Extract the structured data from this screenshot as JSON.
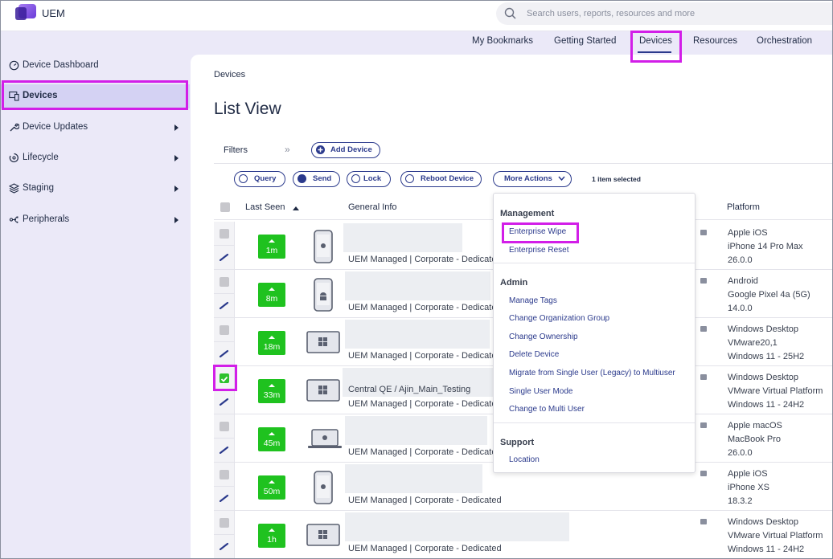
{
  "app": {
    "name": "UEM"
  },
  "search": {
    "placeholder": "Search users, reports, resources and more"
  },
  "topnav": [
    {
      "label": "My Bookmarks",
      "active": false
    },
    {
      "label": "Getting Started",
      "active": false
    },
    {
      "label": "Devices",
      "active": true
    },
    {
      "label": "Resources",
      "active": false
    },
    {
      "label": "Orchestration",
      "active": false
    }
  ],
  "sidebar": {
    "items": [
      {
        "label": "Device Dashboard",
        "icon": "dashboard-icon",
        "active": false,
        "expandable": false
      },
      {
        "label": "Devices",
        "icon": "devices-icon",
        "active": true,
        "expandable": false
      },
      {
        "label": "Device Updates",
        "icon": "wrench-icon",
        "active": false,
        "expandable": true
      },
      {
        "label": "Lifecycle",
        "icon": "lifecycle-icon",
        "active": false,
        "expandable": true
      },
      {
        "label": "Staging",
        "icon": "staging-icon",
        "active": false,
        "expandable": true
      },
      {
        "label": "Peripherals",
        "icon": "peripherals-icon",
        "active": false,
        "expandable": true
      }
    ]
  },
  "main": {
    "breadcrumb": "Devices",
    "title": "List View",
    "filters_label": "Filters",
    "add_device": "Add Device",
    "actions": {
      "query": "Query",
      "send": "Send",
      "lock": "Lock",
      "reboot": "Reboot Device",
      "more": "More Actions"
    },
    "selection_count": "1 item selected",
    "columns": {
      "last_seen": "Last Seen",
      "general_info": "General Info",
      "platform": "Platform"
    }
  },
  "rows": [
    {
      "last_seen": "1m",
      "device": "phone-ios-icon",
      "checked": false,
      "line1": "",
      "line2": "UEM Managed | Corporate - Dedicated",
      "platform": [
        "Apple iOS",
        "iPhone 14 Pro Max",
        "26.0.0"
      ]
    },
    {
      "last_seen": "8m",
      "device": "phone-android-icon",
      "checked": false,
      "line1": "",
      "line2": "UEM Managed | Corporate - Dedicated",
      "platform": [
        "Android",
        "Google Pixel 4a (5G)",
        "14.0.0"
      ]
    },
    {
      "last_seen": "18m",
      "device": "windows-device-icon",
      "checked": false,
      "line1": "",
      "line2": "UEM Managed | Corporate - Dedicated",
      "platform": [
        "Windows Desktop",
        "VMware20,1",
        "Windows 11 - 25H2"
      ]
    },
    {
      "last_seen": "33m",
      "device": "windows-device-icon",
      "checked": true,
      "line1": "Central QE / Ajin_Main_Testing",
      "line2": "UEM Managed | Corporate - Dedicated",
      "platform": [
        "Windows Desktop",
        "VMware Virtual Platform",
        "Windows 11 - 24H2"
      ]
    },
    {
      "last_seen": "45m",
      "device": "macbook-icon",
      "checked": false,
      "line1": "",
      "line2": "UEM Managed | Corporate - Dedicated",
      "platform": [
        "Apple macOS",
        "MacBook Pro",
        "26.0.0"
      ]
    },
    {
      "last_seen": "50m",
      "device": "phone-ios-icon",
      "checked": false,
      "line1": "",
      "line2": "UEM Managed | Corporate - Dedicated",
      "platform": [
        "Apple iOS",
        "iPhone XS",
        "18.3.2"
      ]
    },
    {
      "last_seen": "1h",
      "device": "windows-device-icon",
      "checked": false,
      "line1": "",
      "line2": "UEM Managed | Corporate - Dedicated",
      "platform": [
        "Windows Desktop",
        "VMware Virtual Platform",
        "Windows 11 - 24H2"
      ]
    }
  ],
  "dropdown": {
    "management": {
      "title": "Management",
      "items": [
        "Enterprise Wipe",
        "Enterprise Reset"
      ]
    },
    "admin": {
      "title": "Admin",
      "items": [
        "Manage Tags",
        "Change Organization Group",
        "Change Ownership",
        "Delete Device",
        "Migrate from Single User (Legacy) to Multiuser",
        "Single User Mode",
        "Change to Multi User"
      ]
    },
    "support": {
      "title": "Support",
      "items": [
        "Location"
      ]
    }
  },
  "colors": {
    "accent": "#2b3a8c",
    "highlight": "#d21ee8",
    "status_green": "#1fc21f",
    "band": "#ebe9f8"
  }
}
